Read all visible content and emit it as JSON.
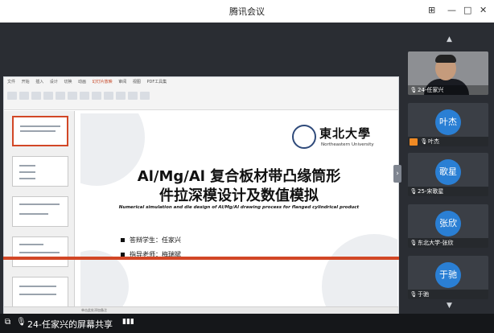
{
  "window": {
    "title": "腾讯会议",
    "controls": [
      "⊞",
      "—",
      "□",
      "✕"
    ]
  },
  "ppt": {
    "tabs": [
      "文件",
      "开始",
      "插入",
      "设计",
      "切换",
      "动画",
      "幻灯片放映",
      "审阅",
      "视图",
      "PDF工具集"
    ],
    "active_tab": "幻灯片放映",
    "statusbar": "单击此处添加备注"
  },
  "slide": {
    "logo_cn": "東北大學",
    "logo_en": "Northeastern University",
    "title_line1": "Al/Mg/Al 复合板材带凸缘筒形",
    "title_line2": "件拉深模设计及数值模拟",
    "subtitle_en": "Numerical simulation and die design of Al/Mg/Al drawing process for flanged cylindrical product",
    "student": "答辩学生：任家兴",
    "advisor": "指导老师：梅瑞斌"
  },
  "participants": [
    {
      "name": "24-任家兴",
      "avatar": "",
      "video": true,
      "cam": false
    },
    {
      "name": "叶杰",
      "avatar": "叶杰",
      "video": false,
      "cam": true
    },
    {
      "name": "25-宋歌星",
      "avatar": "歌星",
      "video": false,
      "cam": false
    },
    {
      "name": "东北大学-张欣",
      "avatar": "张欣",
      "video": false,
      "cam": false
    },
    {
      "name": "于驰",
      "avatar": "于驰",
      "video": false,
      "cam": false
    }
  ],
  "bottom": {
    "share_label": "24-任家兴的屏幕共享"
  },
  "colors": {
    "accent_ppt": "#d24726",
    "avatar_bg": "#2a7fd4"
  }
}
